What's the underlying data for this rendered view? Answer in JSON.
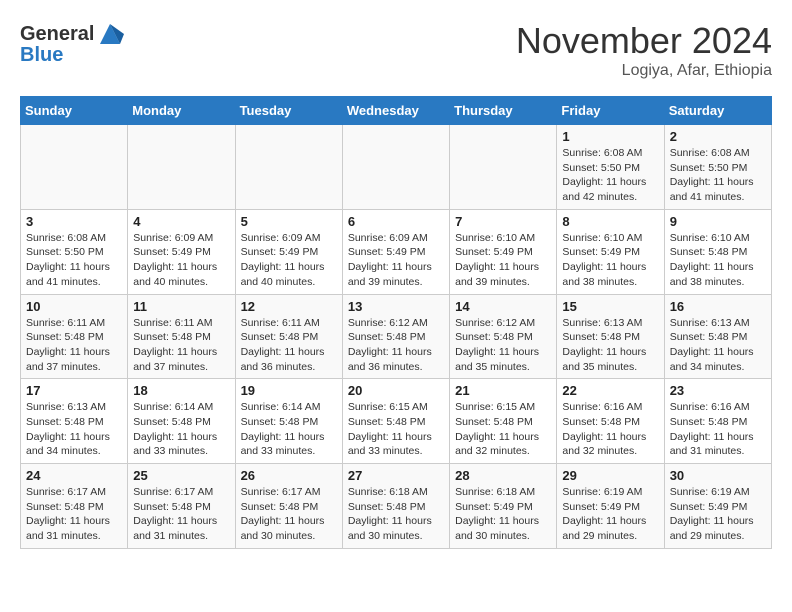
{
  "header": {
    "logo_general": "General",
    "logo_blue": "Blue",
    "month_title": "November 2024",
    "subtitle": "Logiya, Afar, Ethiopia"
  },
  "days_of_week": [
    "Sunday",
    "Monday",
    "Tuesday",
    "Wednesday",
    "Thursday",
    "Friday",
    "Saturday"
  ],
  "weeks": [
    [
      {
        "day": "",
        "info": ""
      },
      {
        "day": "",
        "info": ""
      },
      {
        "day": "",
        "info": ""
      },
      {
        "day": "",
        "info": ""
      },
      {
        "day": "",
        "info": ""
      },
      {
        "day": "1",
        "info": "Sunrise: 6:08 AM\nSunset: 5:50 PM\nDaylight: 11 hours\nand 42 minutes."
      },
      {
        "day": "2",
        "info": "Sunrise: 6:08 AM\nSunset: 5:50 PM\nDaylight: 11 hours\nand 41 minutes."
      }
    ],
    [
      {
        "day": "3",
        "info": "Sunrise: 6:08 AM\nSunset: 5:50 PM\nDaylight: 11 hours\nand 41 minutes."
      },
      {
        "day": "4",
        "info": "Sunrise: 6:09 AM\nSunset: 5:49 PM\nDaylight: 11 hours\nand 40 minutes."
      },
      {
        "day": "5",
        "info": "Sunrise: 6:09 AM\nSunset: 5:49 PM\nDaylight: 11 hours\nand 40 minutes."
      },
      {
        "day": "6",
        "info": "Sunrise: 6:09 AM\nSunset: 5:49 PM\nDaylight: 11 hours\nand 39 minutes."
      },
      {
        "day": "7",
        "info": "Sunrise: 6:10 AM\nSunset: 5:49 PM\nDaylight: 11 hours\nand 39 minutes."
      },
      {
        "day": "8",
        "info": "Sunrise: 6:10 AM\nSunset: 5:49 PM\nDaylight: 11 hours\nand 38 minutes."
      },
      {
        "day": "9",
        "info": "Sunrise: 6:10 AM\nSunset: 5:48 PM\nDaylight: 11 hours\nand 38 minutes."
      }
    ],
    [
      {
        "day": "10",
        "info": "Sunrise: 6:11 AM\nSunset: 5:48 PM\nDaylight: 11 hours\nand 37 minutes."
      },
      {
        "day": "11",
        "info": "Sunrise: 6:11 AM\nSunset: 5:48 PM\nDaylight: 11 hours\nand 37 minutes."
      },
      {
        "day": "12",
        "info": "Sunrise: 6:11 AM\nSunset: 5:48 PM\nDaylight: 11 hours\nand 36 minutes."
      },
      {
        "day": "13",
        "info": "Sunrise: 6:12 AM\nSunset: 5:48 PM\nDaylight: 11 hours\nand 36 minutes."
      },
      {
        "day": "14",
        "info": "Sunrise: 6:12 AM\nSunset: 5:48 PM\nDaylight: 11 hours\nand 35 minutes."
      },
      {
        "day": "15",
        "info": "Sunrise: 6:13 AM\nSunset: 5:48 PM\nDaylight: 11 hours\nand 35 minutes."
      },
      {
        "day": "16",
        "info": "Sunrise: 6:13 AM\nSunset: 5:48 PM\nDaylight: 11 hours\nand 34 minutes."
      }
    ],
    [
      {
        "day": "17",
        "info": "Sunrise: 6:13 AM\nSunset: 5:48 PM\nDaylight: 11 hours\nand 34 minutes."
      },
      {
        "day": "18",
        "info": "Sunrise: 6:14 AM\nSunset: 5:48 PM\nDaylight: 11 hours\nand 33 minutes."
      },
      {
        "day": "19",
        "info": "Sunrise: 6:14 AM\nSunset: 5:48 PM\nDaylight: 11 hours\nand 33 minutes."
      },
      {
        "day": "20",
        "info": "Sunrise: 6:15 AM\nSunset: 5:48 PM\nDaylight: 11 hours\nand 33 minutes."
      },
      {
        "day": "21",
        "info": "Sunrise: 6:15 AM\nSunset: 5:48 PM\nDaylight: 11 hours\nand 32 minutes."
      },
      {
        "day": "22",
        "info": "Sunrise: 6:16 AM\nSunset: 5:48 PM\nDaylight: 11 hours\nand 32 minutes."
      },
      {
        "day": "23",
        "info": "Sunrise: 6:16 AM\nSunset: 5:48 PM\nDaylight: 11 hours\nand 31 minutes."
      }
    ],
    [
      {
        "day": "24",
        "info": "Sunrise: 6:17 AM\nSunset: 5:48 PM\nDaylight: 11 hours\nand 31 minutes."
      },
      {
        "day": "25",
        "info": "Sunrise: 6:17 AM\nSunset: 5:48 PM\nDaylight: 11 hours\nand 31 minutes."
      },
      {
        "day": "26",
        "info": "Sunrise: 6:17 AM\nSunset: 5:48 PM\nDaylight: 11 hours\nand 30 minutes."
      },
      {
        "day": "27",
        "info": "Sunrise: 6:18 AM\nSunset: 5:48 PM\nDaylight: 11 hours\nand 30 minutes."
      },
      {
        "day": "28",
        "info": "Sunrise: 6:18 AM\nSunset: 5:49 PM\nDaylight: 11 hours\nand 30 minutes."
      },
      {
        "day": "29",
        "info": "Sunrise: 6:19 AM\nSunset: 5:49 PM\nDaylight: 11 hours\nand 29 minutes."
      },
      {
        "day": "30",
        "info": "Sunrise: 6:19 AM\nSunset: 5:49 PM\nDaylight: 11 hours\nand 29 minutes."
      }
    ]
  ]
}
